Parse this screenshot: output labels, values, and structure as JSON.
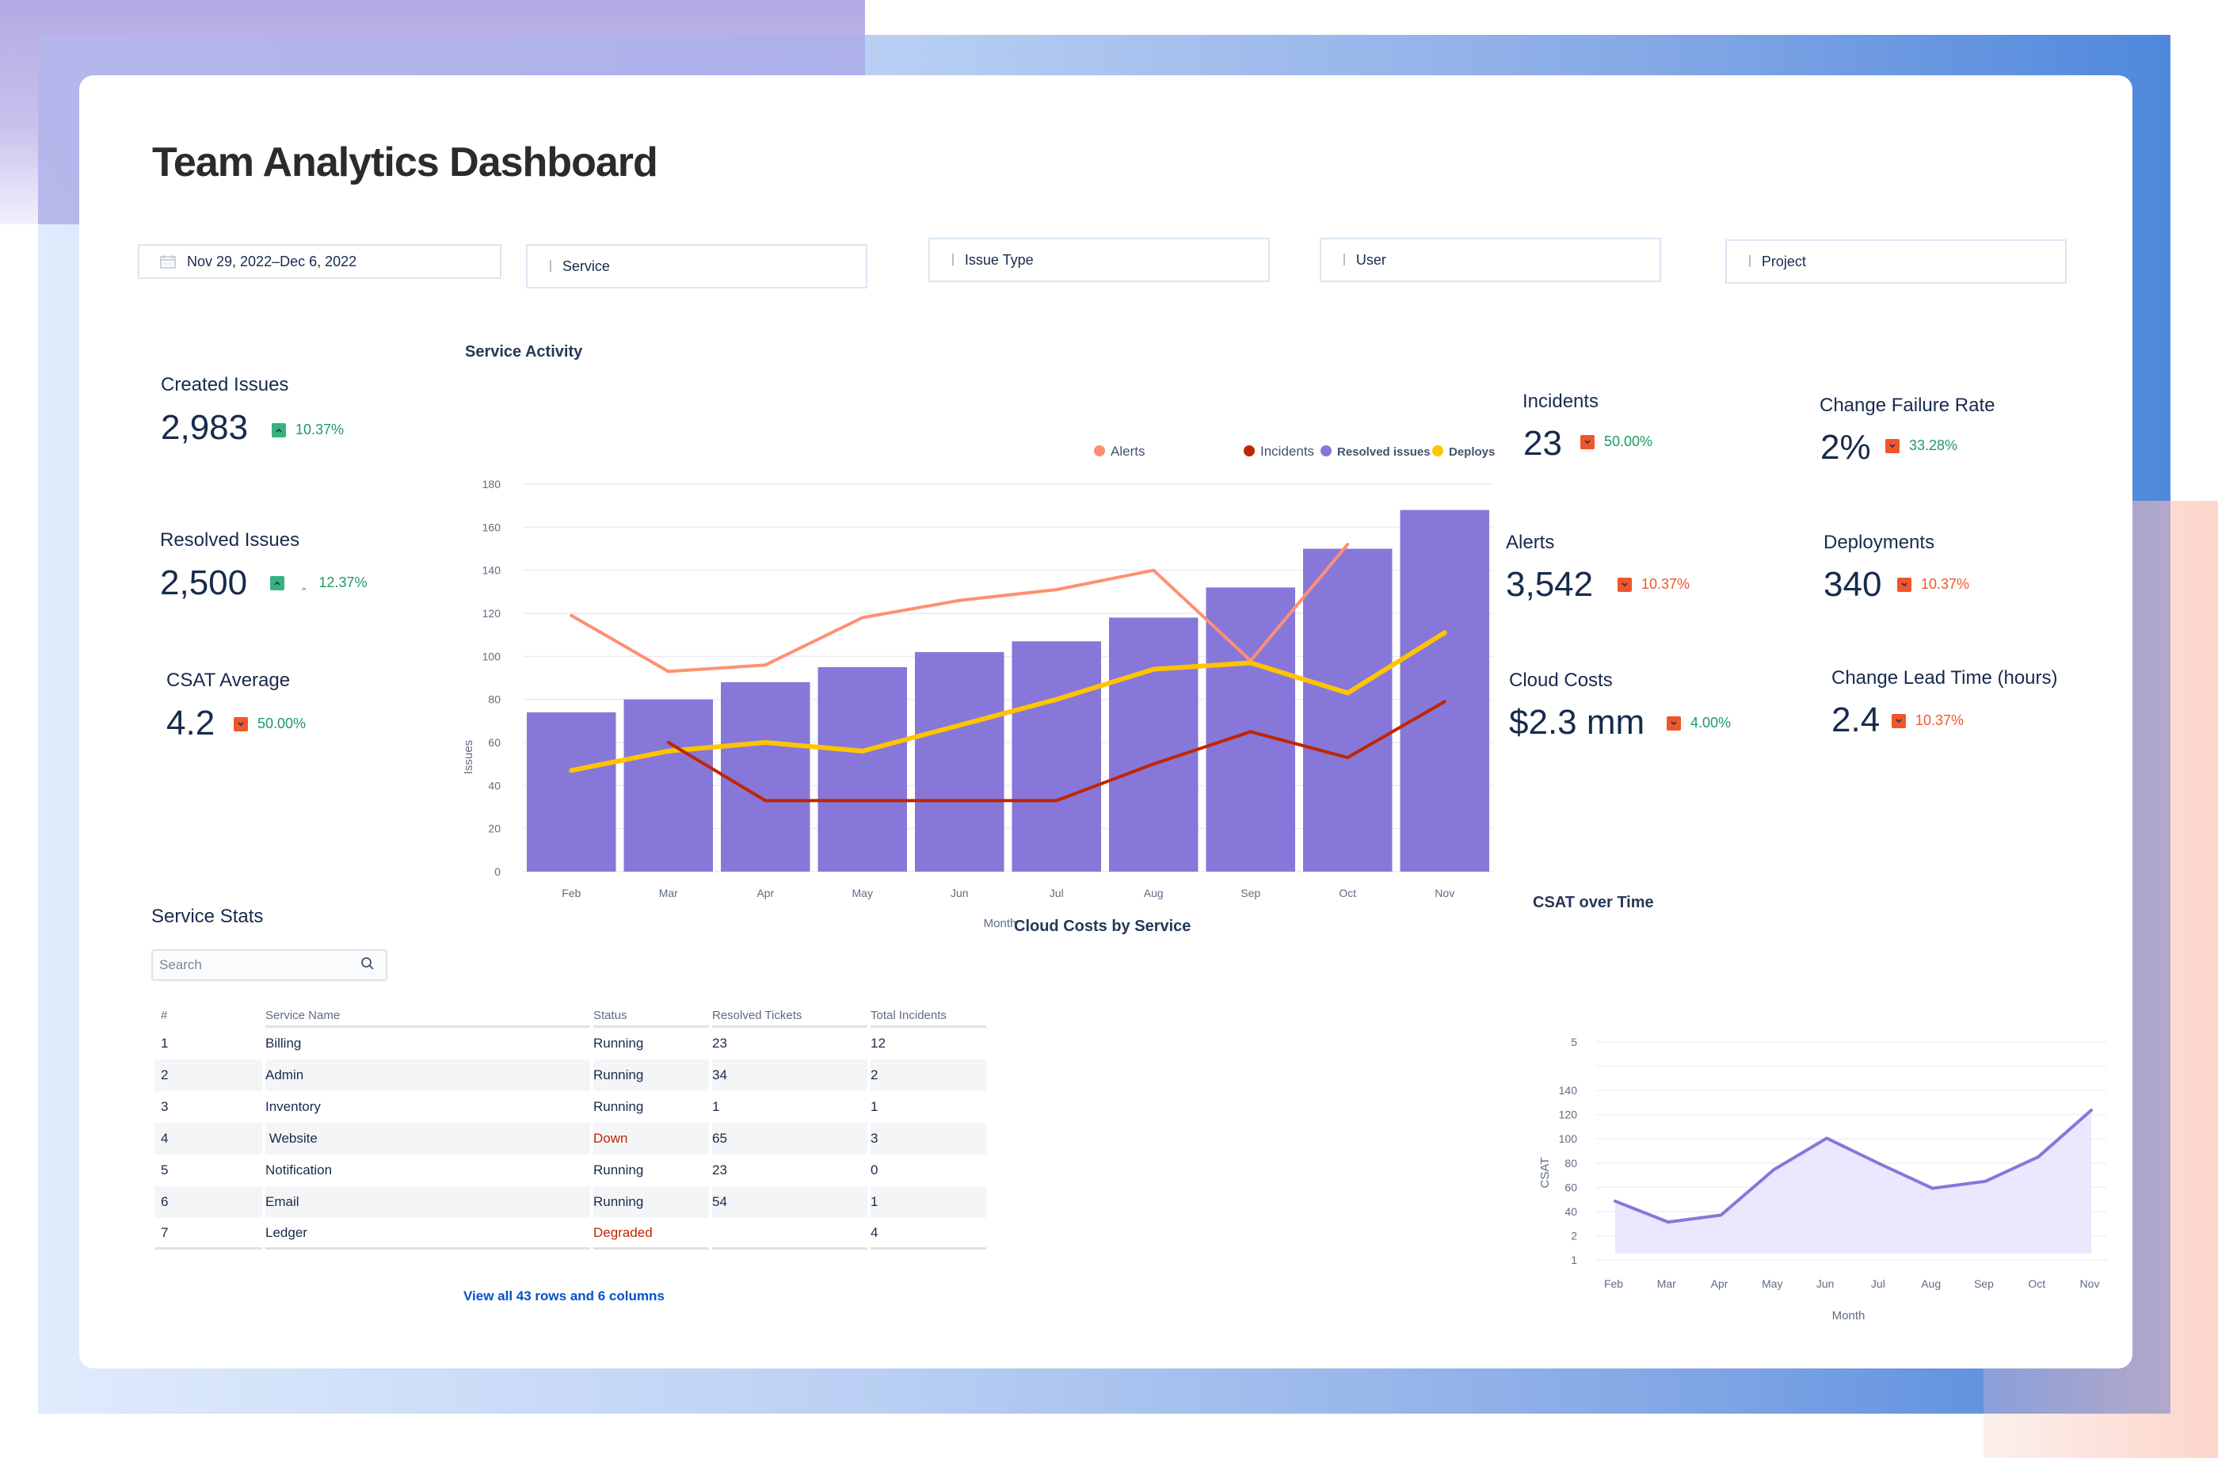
{
  "page": {
    "title": "Team Analytics Dashboard"
  },
  "filters": {
    "date_range": {
      "value": "Nov 29, 2022–Dec 6, 2022",
      "icon": "calendar-icon"
    },
    "service": {
      "label": "Service",
      "icon": "text-cursor-icon"
    },
    "issue_type": {
      "label": "Issue Type",
      "icon": "text-cursor-icon"
    },
    "user": {
      "label": "User",
      "icon": "text-cursor-icon"
    },
    "project": {
      "label": "Project",
      "icon": "text-cursor-icon"
    }
  },
  "kpis_left": {
    "created_issues": {
      "label": "Created Issues",
      "value": "2,983",
      "delta": "10.37%",
      "direction": "up",
      "delta_color": "green"
    },
    "resolved_issues": {
      "label": "Resolved Issues",
      "value": "2,500",
      "delta": "12.37%",
      "direction": "up",
      "delta_color": "green"
    },
    "csat_average": {
      "label": "CSAT Average",
      "value": "4.2",
      "delta": "50.00%",
      "direction": "down",
      "delta_color": "green"
    }
  },
  "kpis_right": {
    "incidents": {
      "label": "Incidents",
      "value": "23",
      "delta": "50.00%",
      "direction": "down",
      "delta_color": "green"
    },
    "change_failure_rate": {
      "label": "Change Failure Rate",
      "value": "2%",
      "delta": "33.28%",
      "direction": "down",
      "delta_color": "green"
    },
    "alerts": {
      "label": "Alerts",
      "value": "3,542",
      "delta": "10.37%",
      "direction": "down",
      "delta_color": "red"
    },
    "deployments": {
      "label": "Deployments",
      "value": "340",
      "delta": "10.37%",
      "direction": "down",
      "delta_color": "red"
    },
    "cloud_costs": {
      "label": "Cloud Costs",
      "value": "$2.3 mm",
      "delta": "4.00%",
      "direction": "down",
      "delta_color": "green"
    },
    "change_lead_time": {
      "label": "Change Lead Time (hours)",
      "value": "2.4",
      "delta": "10.37%",
      "direction": "down",
      "delta_color": "red"
    }
  },
  "colors": {
    "resolved": "#8777d9",
    "alerts": "#ff8f73",
    "incidents": "#bf2600",
    "deploys": "#ffc400",
    "up_badge": "#36b37e",
    "down_badge": "#f1562a",
    "green_text": "#1f9a63",
    "red_text": "#f1562a",
    "link": "#0052cc",
    "csat_line": "#8777d9",
    "csat_fill": "#eae6ff"
  },
  "chart_data": [
    {
      "type": "bar",
      "title": "Service Activity",
      "xlabel": "Month",
      "ylabel": "Issues",
      "ylim": [
        0,
        180
      ],
      "yticks": [
        0,
        20,
        40,
        60,
        80,
        100,
        120,
        140,
        160,
        180
      ],
      "grid": true,
      "legend_position": "top-right",
      "categories": [
        "Feb",
        "Mar",
        "Apr",
        "May",
        "Jun",
        "Jul",
        "Aug",
        "Sep",
        "Oct",
        "Nov"
      ],
      "series": [
        {
          "name": "Resolved issues",
          "kind": "bar",
          "values": [
            74,
            80,
            88,
            95,
            102,
            107,
            118,
            132,
            150,
            168
          ]
        },
        {
          "name": "Alerts",
          "kind": "line",
          "values": [
            119,
            93,
            96,
            118,
            126,
            131,
            140,
            98,
            152,
            null
          ]
        },
        {
          "name": "Incidents",
          "kind": "line",
          "values": [
            null,
            60,
            33,
            33,
            33,
            33,
            50,
            65,
            53,
            79
          ]
        },
        {
          "name": "Deploys",
          "kind": "line",
          "values": [
            47,
            56,
            60,
            56,
            68,
            80,
            94,
            97,
            83,
            111
          ]
        }
      ],
      "legend": [
        "Alerts",
        "Incidents",
        "Resolved issues",
        "Deploys"
      ]
    },
    {
      "type": "area",
      "title": "CSAT over Time",
      "xlabel": "Month",
      "ylabel": "CSAT",
      "ytick_labels": [
        "1",
        "2",
        "40",
        "60",
        "80",
        "100",
        "120",
        "140",
        "",
        "5"
      ],
      "grid": true,
      "categories": [
        "Feb",
        "Mar",
        "Apr",
        "May",
        "Jun",
        "Jul",
        "Aug",
        "Sep",
        "Oct",
        "Nov"
      ],
      "series": [
        {
          "name": "CSAT",
          "values": [
            45,
            27,
            33,
            72,
            99,
            77,
            56,
            62,
            83,
            123
          ]
        }
      ]
    }
  ],
  "cloud_costs_by_service": {
    "title": "Cloud Costs by Service"
  },
  "service_stats": {
    "title": "Service Stats",
    "search_placeholder": "Search",
    "columns": [
      "#",
      "Service Name",
      "Status",
      "Resolved Tickets",
      "Total Incidents"
    ],
    "rows": [
      {
        "num": "1",
        "name": "Billing",
        "status": "Running",
        "resolved": "23",
        "incidents": "12"
      },
      {
        "num": "2",
        "name": "Admin",
        "status": "Running",
        "resolved": "34",
        "incidents": "2"
      },
      {
        "num": "3",
        "name": "Inventory",
        "status": "Running",
        "resolved": "1",
        "incidents": "1"
      },
      {
        "num": "4",
        "name": " Website",
        "status": "Down",
        "resolved": "65",
        "incidents": "3"
      },
      {
        "num": "5",
        "name": "Notification",
        "status": "Running",
        "resolved": "23",
        "incidents": "0"
      },
      {
        "num": "6",
        "name": "Email",
        "status": "Running",
        "resolved": "54",
        "incidents": "1"
      },
      {
        "num": "7",
        "name": "Ledger",
        "status": "Degraded",
        "resolved": "",
        "incidents": "4"
      }
    ],
    "view_all_link": "View all 43 rows and 6 columns"
  }
}
